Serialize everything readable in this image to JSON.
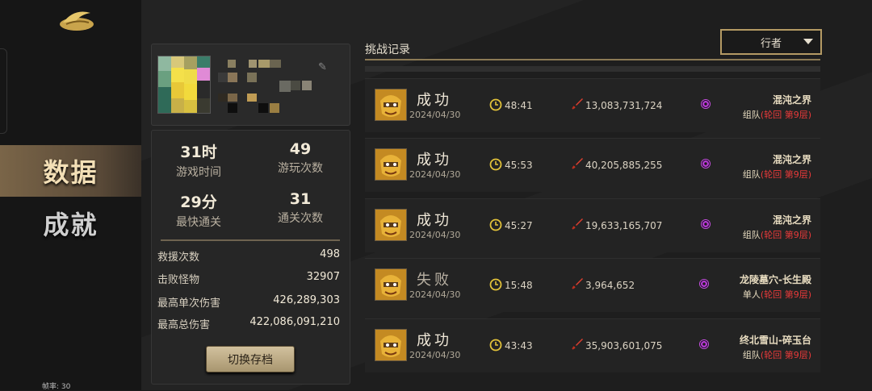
{
  "sidebar": {
    "nav": [
      {
        "label": "数据",
        "active": true
      },
      {
        "label": "成就",
        "active": false
      }
    ],
    "fps_label": "帧率: 30"
  },
  "profile": {
    "stats_big": [
      {
        "value": "31时",
        "label": "游戏时间"
      },
      {
        "value": "49",
        "label": "游玩次数"
      },
      {
        "value": "29分",
        "label": "最快通关"
      },
      {
        "value": "31",
        "label": "通关次数"
      }
    ],
    "stats_rows": [
      {
        "label": "救援次数",
        "value": "498"
      },
      {
        "label": "击败怪物",
        "value": "32907"
      },
      {
        "label": "最高单次伤害",
        "value": "426,289,303"
      },
      {
        "label": "最高总伤害",
        "value": "422,086,091,210"
      }
    ],
    "switch_button": "切换存档"
  },
  "records": {
    "title": "挑战记录",
    "filter_selected": "行者",
    "items": [
      {
        "result": "成功",
        "date": "2024/04/30",
        "time": "48:41",
        "damage": "13,083,731,724",
        "place": "混沌之界",
        "mode_prefix": "组队",
        "mode_detail": "(轮回 第9层)"
      },
      {
        "result": "成功",
        "date": "2024/04/30",
        "time": "45:53",
        "damage": "40,205,885,255",
        "place": "混沌之界",
        "mode_prefix": "组队",
        "mode_detail": "(轮回 第9层)"
      },
      {
        "result": "成功",
        "date": "2024/04/30",
        "time": "45:27",
        "damage": "19,633,165,707",
        "place": "混沌之界",
        "mode_prefix": "组队",
        "mode_detail": "(轮回 第9层)"
      },
      {
        "result": "失败",
        "date": "2024/04/30",
        "time": "15:48",
        "damage": "3,964,652",
        "place": "龙陵墓穴-长生殿",
        "mode_prefix": "单人",
        "mode_detail": "(轮回 第9层)"
      },
      {
        "result": "成功",
        "date": "2024/04/30",
        "time": "43:43",
        "damage": "35,903,601,075",
        "place": "终北雪山-碎玉台",
        "mode_prefix": "组队",
        "mode_detail": "(轮回 第9层)"
      }
    ]
  },
  "colors": {
    "accent_gold": "#b49a64",
    "danger_red": "#e83a3a",
    "portal_purple": "#b43ad0"
  }
}
